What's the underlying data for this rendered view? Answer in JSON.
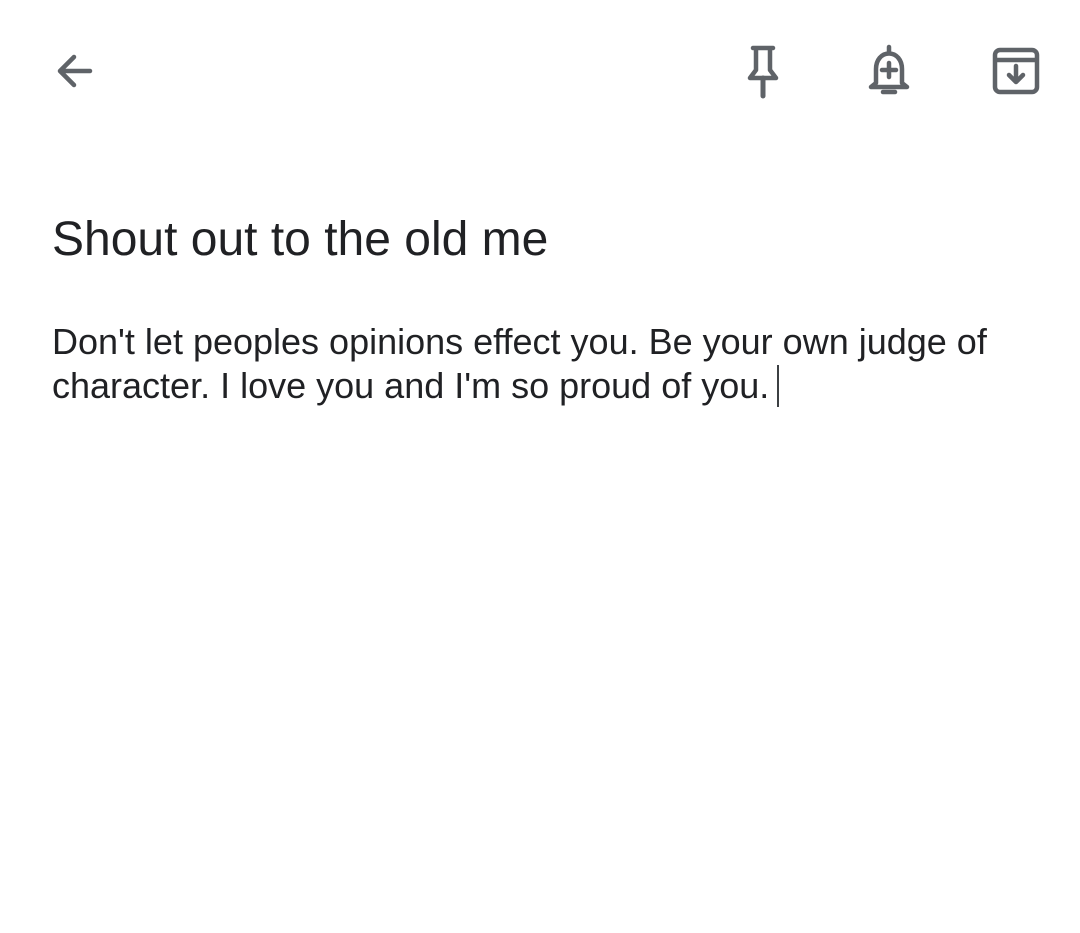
{
  "toolbar": {
    "back_icon": "arrow-left-icon",
    "pin_icon": "pin-icon",
    "reminder_icon": "bell-plus-icon",
    "archive_icon": "archive-icon",
    "icon_color": "#5f6368"
  },
  "note": {
    "title": "Shout out to the old me",
    "body": "Don't let peoples opinions effect you. Be your own judge of character. I love you and I'm so proud of you."
  }
}
